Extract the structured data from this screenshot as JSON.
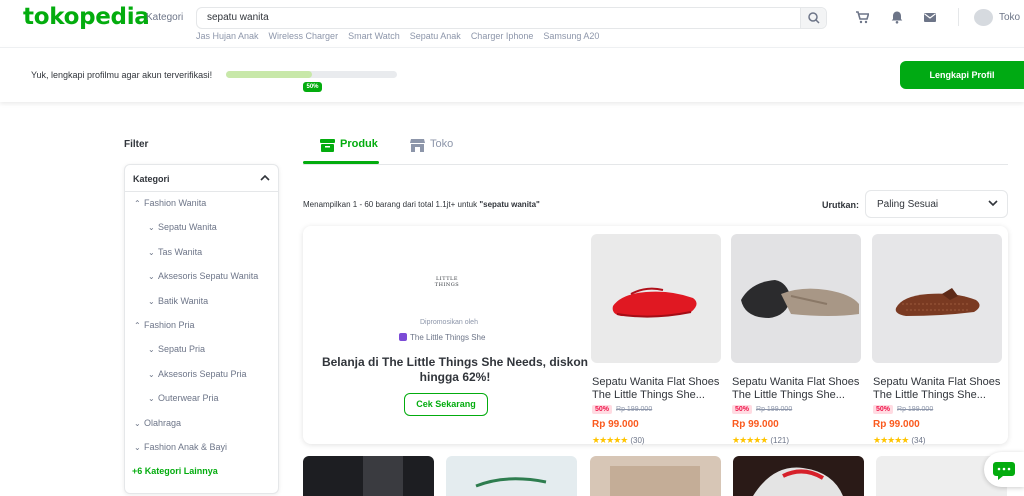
{
  "header": {
    "logo": "tokopedia",
    "kategori": "Kategori",
    "search_value": "sepatu wanita",
    "quick_links": [
      "Jas Hujan Anak",
      "Wireless Charger",
      "Smart Watch",
      "Sepatu Anak",
      "Charger Iphone",
      "Samsung A20"
    ],
    "shop_label": "Toko"
  },
  "profile": {
    "prompt": "Yuk, lengkapi profilmu agar akun terverifikasi!",
    "progress_percent": 50,
    "progress_label": "50%",
    "button": "Lengkapi Profil"
  },
  "filter": {
    "title": "Filter",
    "section": "Kategori",
    "items": [
      {
        "label": "Fashion Wanita",
        "level": 0,
        "expanded": true
      },
      {
        "label": "Sepatu Wanita",
        "level": 1
      },
      {
        "label": "Tas Wanita",
        "level": 1
      },
      {
        "label": "Aksesoris Sepatu Wanita",
        "level": 1
      },
      {
        "label": "Batik Wanita",
        "level": 1
      },
      {
        "label": "Fashion Pria",
        "level": 0,
        "expanded": true
      },
      {
        "label": "Sepatu Pria",
        "level": 1
      },
      {
        "label": "Aksesoris Sepatu Pria",
        "level": 1
      },
      {
        "label": "Outerwear Pria",
        "level": 1
      },
      {
        "label": "Olahraga",
        "level": 0
      },
      {
        "label": "Fashion Anak & Bayi",
        "level": 0
      }
    ],
    "more": "+6 Kategori Lainnya"
  },
  "tabs": {
    "produk": "Produk",
    "toko": "Toko"
  },
  "results": {
    "prefix": "Menampilkan 1 - 60 barang dari total 1.1jt+ untuk ",
    "query": "\"sepatu wanita\""
  },
  "sort": {
    "label": "Urutkan:",
    "value": "Paling Sesuai"
  },
  "promo": {
    "brand_logo": "LITTLE THINGS",
    "promoted_by": "Dipromosikan oleh",
    "shop": "The Little Things She",
    "headline": "Belanja di The Little Things She Needs, diskon hingga 62%!",
    "button": "Cek Sekarang"
  },
  "products": [
    {
      "name": "Sepatu Wanita Flat Shoes The Little Things She...",
      "discount": "50%",
      "original_price": "Rp 199.000",
      "price": "Rp 99.000",
      "stars": "★★★★★",
      "reviews": "(30)"
    },
    {
      "name": "Sepatu Wanita Flat Shoes The Little Things She...",
      "discount": "50%",
      "original_price": "Rp 199.000",
      "price": "Rp 99.000",
      "stars": "★★★★★",
      "reviews": "(121)"
    },
    {
      "name": "Sepatu Wanita Flat Shoes The Little Things She...",
      "discount": "50%",
      "original_price": "Rp 199.000",
      "price": "Rp 99.000",
      "stars": "★★★★★",
      "reviews": "(34)"
    }
  ],
  "colors": {
    "brand_green": "#03ac0e",
    "price_orange": "#fa591d",
    "discount_red": "#ef144a"
  }
}
